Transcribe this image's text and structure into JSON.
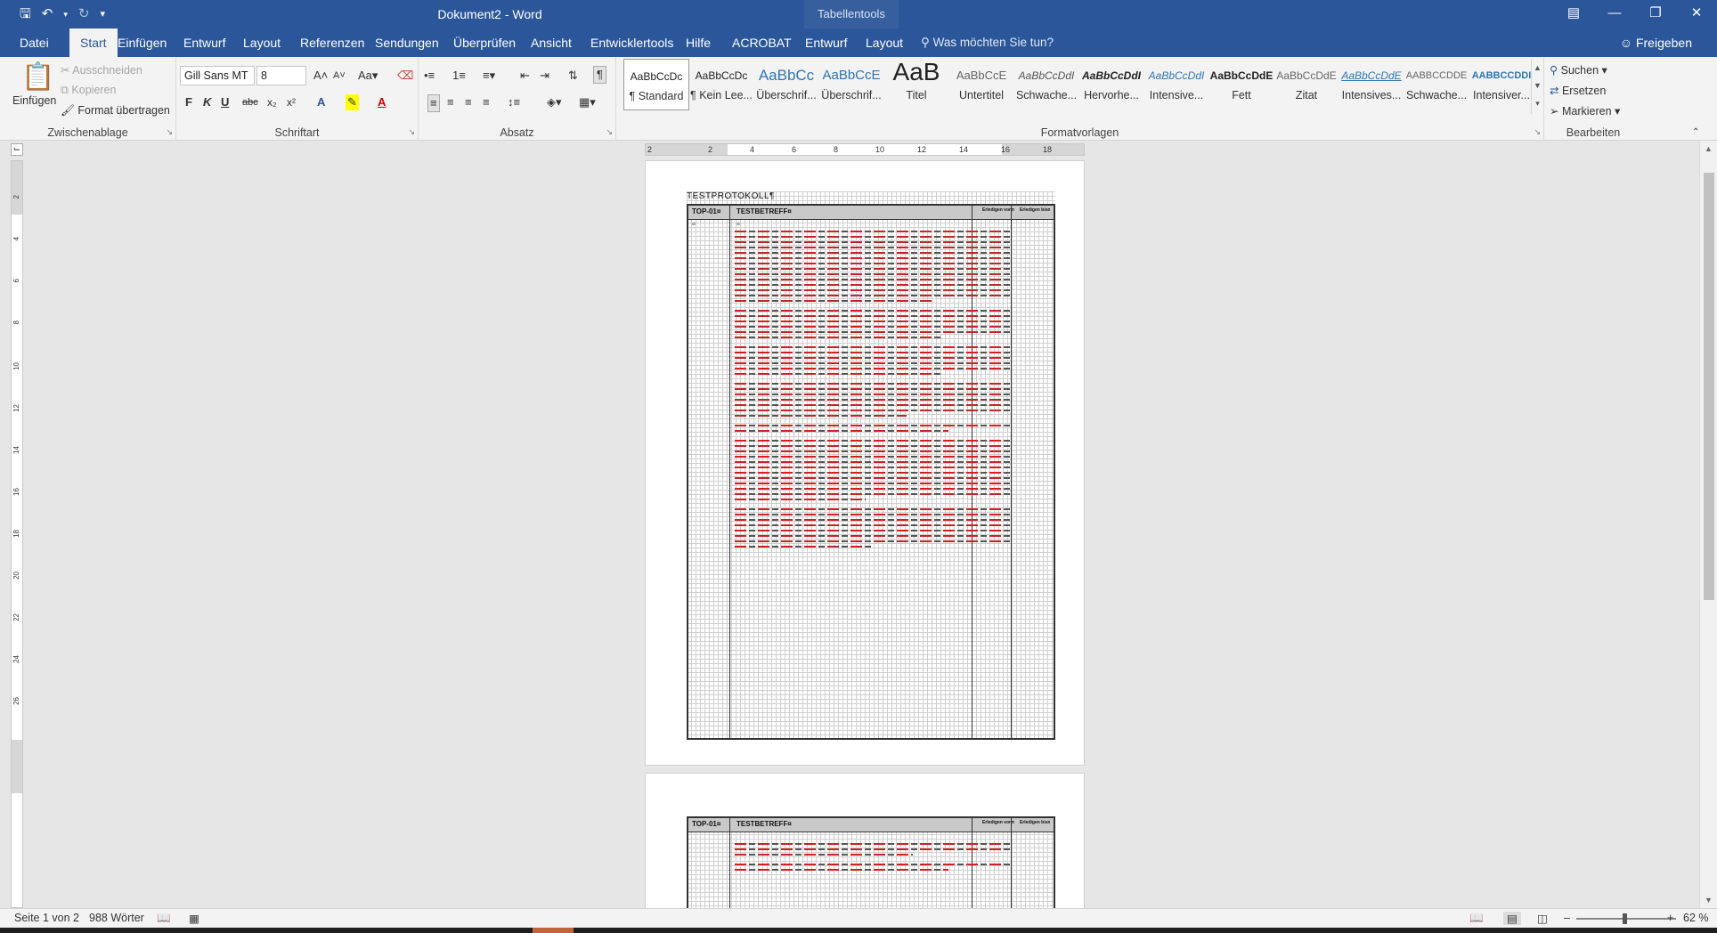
{
  "window": {
    "title": "Dokument2 - Word",
    "context_title": "Tabellentools",
    "share": "Freigeben",
    "tell_me": "Was möchten Sie tun?"
  },
  "tabs": [
    {
      "label": "Datei"
    },
    {
      "label": "Start"
    },
    {
      "label": "Einfügen"
    },
    {
      "label": "Entwurf"
    },
    {
      "label": "Layout"
    },
    {
      "label": "Referenzen"
    },
    {
      "label": "Sendungen"
    },
    {
      "label": "Überprüfen"
    },
    {
      "label": "Ansicht"
    },
    {
      "label": "Entwicklertools"
    },
    {
      "label": "Hilfe"
    },
    {
      "label": "ACROBAT"
    },
    {
      "label": "Entwurf"
    },
    {
      "label": "Layout"
    }
  ],
  "ribbon": {
    "clipboard": {
      "label": "Zwischenablage",
      "paste": "Einfügen",
      "cut": "Ausschneiden",
      "copy": "Kopieren",
      "format_painter": "Format übertragen"
    },
    "font": {
      "label": "Schriftart",
      "font_name": "Gill Sans MT",
      "font_size": "8"
    },
    "paragraph": {
      "label": "Absatz"
    },
    "styles": {
      "label": "Formatvorlagen",
      "items": [
        {
          "preview": "AaBbCcDc",
          "name": "¶ Standard"
        },
        {
          "preview": "AaBbCcDc",
          "name": "¶ Kein Lee..."
        },
        {
          "preview": "AaBbCc",
          "name": "Überschrif..."
        },
        {
          "preview": "AaBbCcE",
          "name": "Überschrif..."
        },
        {
          "preview": "AaB",
          "name": "Titel"
        },
        {
          "preview": "AaBbCcE",
          "name": "Untertitel"
        },
        {
          "preview": "AaBbCcDdI",
          "name": "Schwache..."
        },
        {
          "preview": "AaBbCcDdI",
          "name": "Hervorhe..."
        },
        {
          "preview": "AaBbCcDdI",
          "name": "Intensive..."
        },
        {
          "preview": "AaBbCcDdE",
          "name": "Fett"
        },
        {
          "preview": "AaBbCcDdE",
          "name": "Zitat"
        },
        {
          "preview": "AaBbCcDdE",
          "name": "Intensives..."
        },
        {
          "preview": "AABBCCDDE",
          "name": "Schwache..."
        },
        {
          "preview": "AABBCCDDI",
          "name": "Intensiver..."
        }
      ]
    },
    "editing": {
      "label": "Bearbeiten",
      "find": "Suchen",
      "replace": "Ersetzen",
      "select": "Markieren"
    }
  },
  "ruler": {
    "h_ticks": [
      "2",
      "2",
      "4",
      "6",
      "8",
      "10",
      "12",
      "14",
      "16",
      "18"
    ],
    "v_ticks": [
      "2",
      "4",
      "6",
      "8",
      "10",
      "12",
      "14",
      "16",
      "18",
      "20",
      "22",
      "24",
      "26"
    ]
  },
  "document": {
    "heading": "TESTPROTOKOLL¶",
    "col_top": "TOP-01¤",
    "col_betreff": "TESTBETREFF¤",
    "col_a": "Erledigen von¤",
    "col_b": "Erledigen bis¤",
    "paragraphs": [
      14,
      6,
      6,
      7,
      2,
      12,
      8
    ],
    "page2_paragraphs": [
      3,
      2
    ]
  },
  "status": {
    "page": "Seite 1 von 2",
    "words": "988 Wörter",
    "zoom": "62 %"
  },
  "colors": {
    "brand": "#2b579a",
    "ribbon": "#f3f3f3",
    "workspace": "#e6e6e6",
    "markup_red": "#cc2222"
  }
}
